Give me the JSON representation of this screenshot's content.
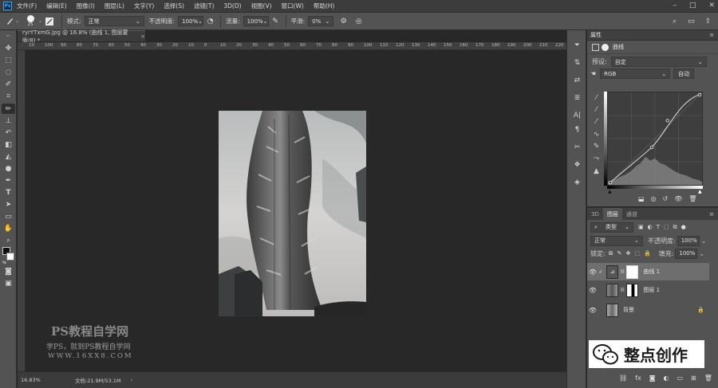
{
  "menubar": {
    "items": [
      "文件(F)",
      "编辑(E)",
      "图像(I)",
      "图层(L)",
      "文字(Y)",
      "选择(S)",
      "滤镜(T)",
      "3D(D)",
      "视图(V)",
      "窗口(W)",
      "帮助(H)"
    ]
  },
  "options": {
    "brush_size": "25",
    "mode_label": "模式:",
    "mode_value": "正常",
    "opacity_label": "不透明度:",
    "opacity_value": "100%",
    "flow_label": "流量:",
    "flow_value": "100%",
    "smooth_label": "平滑:",
    "smooth_value": "0%"
  },
  "document": {
    "tab_title": "ryrYTxmG.jpg @ 16.8% (曲线 1, 图层蒙版/8) *",
    "ruler_ticks": [
      "10",
      "100",
      "90",
      "80",
      "70",
      "60",
      "50",
      "40",
      "30",
      "20",
      "10",
      "0",
      "10",
      "20",
      "30",
      "40",
      "50",
      "60",
      "70",
      "80",
      "90",
      "100",
      "110",
      "120",
      "130",
      "140",
      "150",
      "160",
      "170",
      "180",
      "190",
      "200",
      "210",
      "220"
    ],
    "zoom": "16.83%",
    "doc_info": "文档:21.9M/53.1M"
  },
  "watermark": {
    "line1": "PS教程自学网",
    "line2": "学PS，就到PS教程自学网",
    "line3": "WWW.16XX8.COM"
  },
  "properties": {
    "tab": "属性",
    "adjustment_name": "曲线",
    "preset_label": "预设:",
    "preset_value": "自定",
    "channel": "RGB",
    "auto_button": "自动"
  },
  "layers_panel": {
    "tabs": [
      "3D",
      "图层",
      "通道"
    ],
    "filter_kind": "类型",
    "blend_mode": "正常",
    "opacity_label": "不透明度:",
    "opacity_value": "100%",
    "lock_label": "锁定:",
    "fill_label": "填充:",
    "fill_value": "100%",
    "layers": [
      {
        "name": "曲线 1"
      },
      {
        "name": "图层 1"
      },
      {
        "name": "背景"
      }
    ]
  },
  "badge": {
    "text": "整点创作"
  }
}
